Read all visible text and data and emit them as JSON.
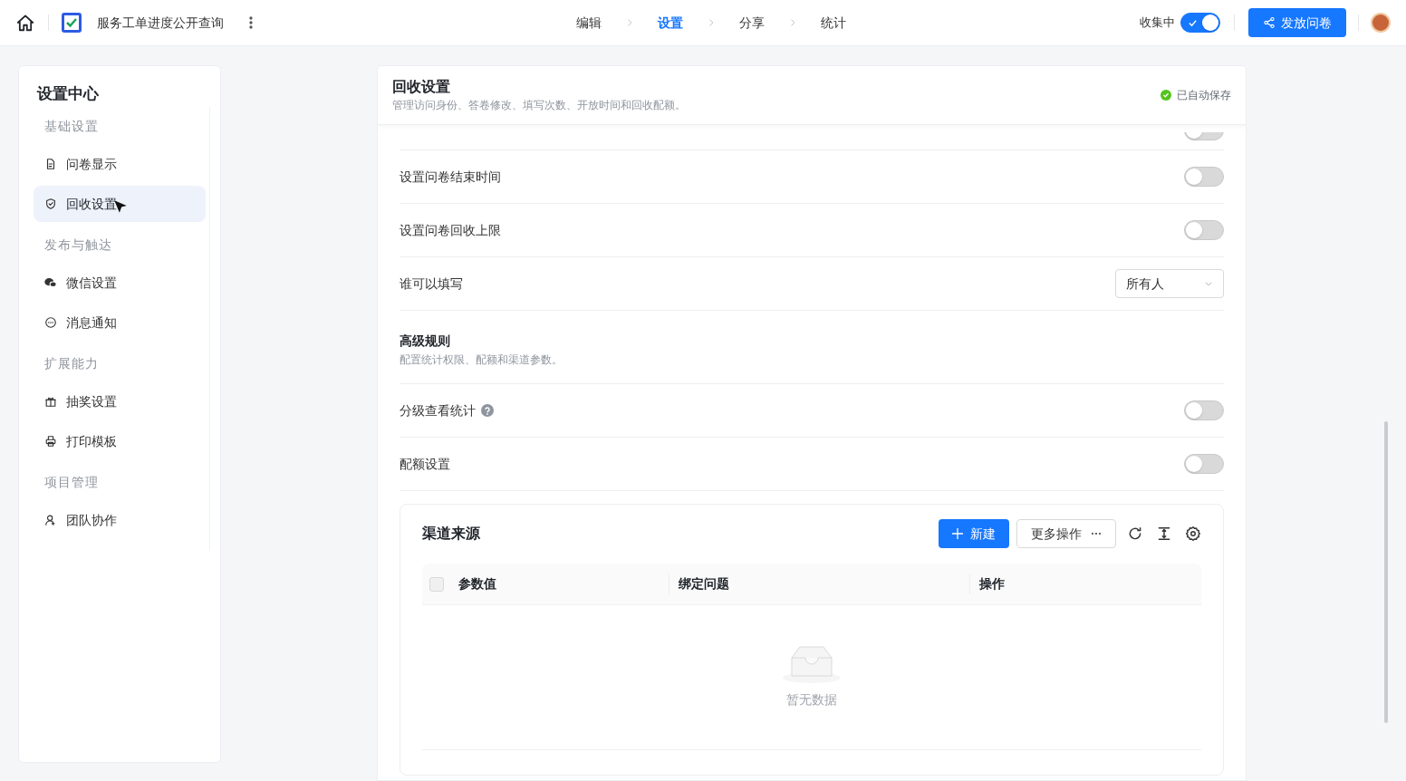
{
  "header": {
    "title": "服务工单进度公开查询",
    "steps": [
      {
        "label": "编辑",
        "selected": false
      },
      {
        "label": "设置",
        "selected": true
      },
      {
        "label": "分享",
        "selected": false
      },
      {
        "label": "统计",
        "selected": false
      }
    ],
    "collect": {
      "label": "收集中",
      "on": true
    },
    "publish_button": "发放问卷"
  },
  "sidebar": {
    "title": "设置中心",
    "items": [
      {
        "kind": "group",
        "label": "基础设置"
      },
      {
        "kind": "item",
        "label": "问卷显示",
        "selected": false
      },
      {
        "kind": "item",
        "label": "回收设置",
        "selected": true
      },
      {
        "kind": "group",
        "label": "发布与触达"
      },
      {
        "kind": "item",
        "label": "微信设置",
        "selected": false
      },
      {
        "kind": "item",
        "label": "消息通知",
        "selected": false
      },
      {
        "kind": "group",
        "label": "扩展能力"
      },
      {
        "kind": "item",
        "label": "抽奖设置",
        "selected": false
      },
      {
        "kind": "item",
        "label": "打印模板",
        "selected": false
      },
      {
        "kind": "group",
        "label": "项目管理"
      },
      {
        "kind": "item",
        "label": "团队协作",
        "selected": false
      }
    ]
  },
  "panel": {
    "title": "回收设置",
    "description": "管理访问身份、答卷修改、填写次数、开放时间和回收配额。",
    "save_status": "已自动保存",
    "rows": [
      {
        "kind": "hidden-toggle",
        "on": false
      },
      {
        "kind": "toggle",
        "label": "设置问卷结束时间",
        "on": false
      },
      {
        "kind": "toggle",
        "label": "设置问卷回收上限",
        "on": false
      },
      {
        "kind": "select",
        "label": "谁可以填写",
        "value": "所有人"
      },
      {
        "kind": "section",
        "label": "高级规则",
        "description": "配置统计权限、配额和渠道参数。"
      },
      {
        "kind": "toggle",
        "label": "分级查看统计",
        "help": true,
        "on": false
      },
      {
        "kind": "toggle",
        "label": "配额设置",
        "on": false
      }
    ],
    "channel_table": {
      "title": "渠道来源",
      "new_button": "新建",
      "more_button": "更多操作",
      "columns": [
        "参数值",
        "绑定问题",
        "操作"
      ],
      "select_all_checked": false,
      "empty_text": "暂无数据"
    }
  }
}
